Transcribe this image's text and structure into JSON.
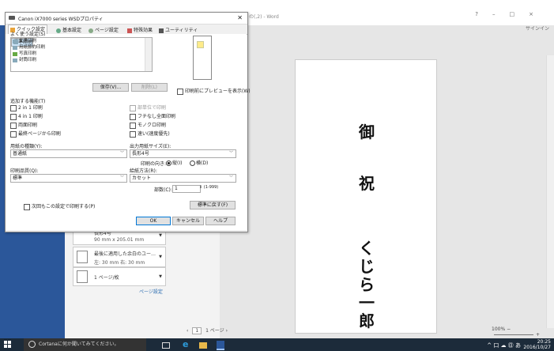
{
  "word": {
    "title": "の(,2) - Word",
    "signin": "サインイン",
    "window_buttons": [
      "?",
      "–",
      "□",
      "×"
    ],
    "doc_text": [
      "御",
      "祝",
      "く",
      "じ",
      "ら",
      "一",
      "郎"
    ],
    "page_nav": {
      "prev": "‹",
      "page": "1",
      "total": "1 ページ",
      "next": "›"
    },
    "zoom": "100%",
    "left_panel": {
      "item1": {
        "line1": "長形4号",
        "line2": "90 mm x 205.01 mm"
      },
      "item2": {
        "line1": "最後に適用した余白のユー…",
        "line2": "左:  30 mm   右:  30 mm"
      },
      "item3": {
        "line1": "1 ページ/枚"
      },
      "setting_link": "ページ設定"
    }
  },
  "dialog": {
    "title": "Canon iX7000 series WSDプロパティ",
    "tabs": [
      "クイック設定",
      "基本設定",
      "ページ設定",
      "特殊効果",
      "ユーティリティ"
    ],
    "favorites_label": "よく使う設定(S)",
    "favorites": [
      "標準印刷",
      "文書印刷",
      "用紙節約印刷",
      "写真印刷",
      "封筒印刷"
    ],
    "save_btn": "保存(V)...",
    "delete_btn": "削除(L)",
    "preview_chk": "印刷前にプレビューを表示(W)",
    "additional_label": "追加する機能(T)",
    "left_checks": [
      "2 in 1 印刷",
      "4 in 1 印刷",
      "両面印刷",
      "最終ページから印刷"
    ],
    "right_checks": [
      "部単位で印刷",
      "フチなし全面印刷",
      "モノクロ印刷",
      "速い(速度優先)"
    ],
    "paper_type_label": "用紙の種類(Y):",
    "paper_type_value": "普通紙",
    "paper_size_label": "出力用紙サイズ(E):",
    "paper_size_value": "長形4号",
    "orientation_label": "印刷の向き:",
    "orientation_portrait": "縦(I)",
    "orientation_landscape": "横(D)",
    "quality_label": "印刷品質(Q):",
    "quality_value": "標準",
    "feed_label": "給紙方法(R):",
    "feed_value": "カセット",
    "copies_label": "部数(C):",
    "copies_value": "1",
    "copies_range": "(1-999)",
    "always_chk": "次回もこの設定で印刷する(P)",
    "defaults_btn": "標準に戻す(F)",
    "ok_btn": "OK",
    "cancel_btn": "キャンセル",
    "help_btn": "ヘルプ"
  },
  "taskbar": {
    "search_placeholder": "Cortanaに何か聞いてみてください。",
    "time": "20:25",
    "date": "2016/10/27",
    "tray_text": "^ 口 ☁ ㊐ あ"
  }
}
